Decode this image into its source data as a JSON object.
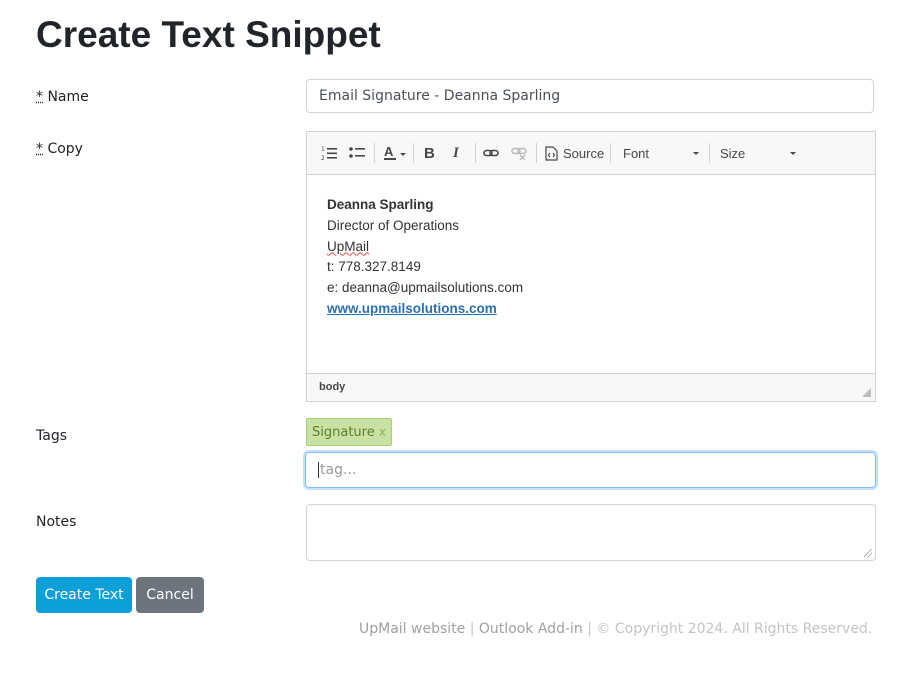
{
  "page": {
    "title": "Create Text Snippet"
  },
  "form": {
    "name_required": "*",
    "name_label": "Name",
    "name_value": "Email Signature - Deanna Sparling",
    "copy_required": "*",
    "copy_label": "Copy",
    "tags_label": "Tags",
    "notes_label": "Notes",
    "notes_value": ""
  },
  "editor": {
    "toolbar": {
      "numbered_list_icon": "numbered-list-icon",
      "bulleted_list_icon": "bulleted-list-icon",
      "text_color_icon": "text-color-icon",
      "bold": "B",
      "italic": "I",
      "link_icon": "link-icon",
      "unlink_icon": "unlink-icon",
      "source_label": "Source",
      "font_label": "Font",
      "size_label": "Size"
    },
    "content": {
      "name": "Deanna Sparling",
      "role": "Director of Operations",
      "company": "UpMail",
      "phone": "t: 778.327.8149",
      "email": "e: deanna@upmailsolutions.com",
      "website": "www.upmailsolutions.com"
    },
    "path": "body"
  },
  "tags": {
    "items": [
      {
        "label": "Signature",
        "remove": "x"
      }
    ],
    "placeholder": "tag..."
  },
  "buttons": {
    "create": "Create Text",
    "cancel": "Cancel"
  },
  "footer": {
    "website_link": "UpMail website",
    "sep1": "|",
    "addin_link": "Outlook Add-in",
    "sep2": "|",
    "copyright": "© Copyright 2024. All Rights Reserved."
  }
}
